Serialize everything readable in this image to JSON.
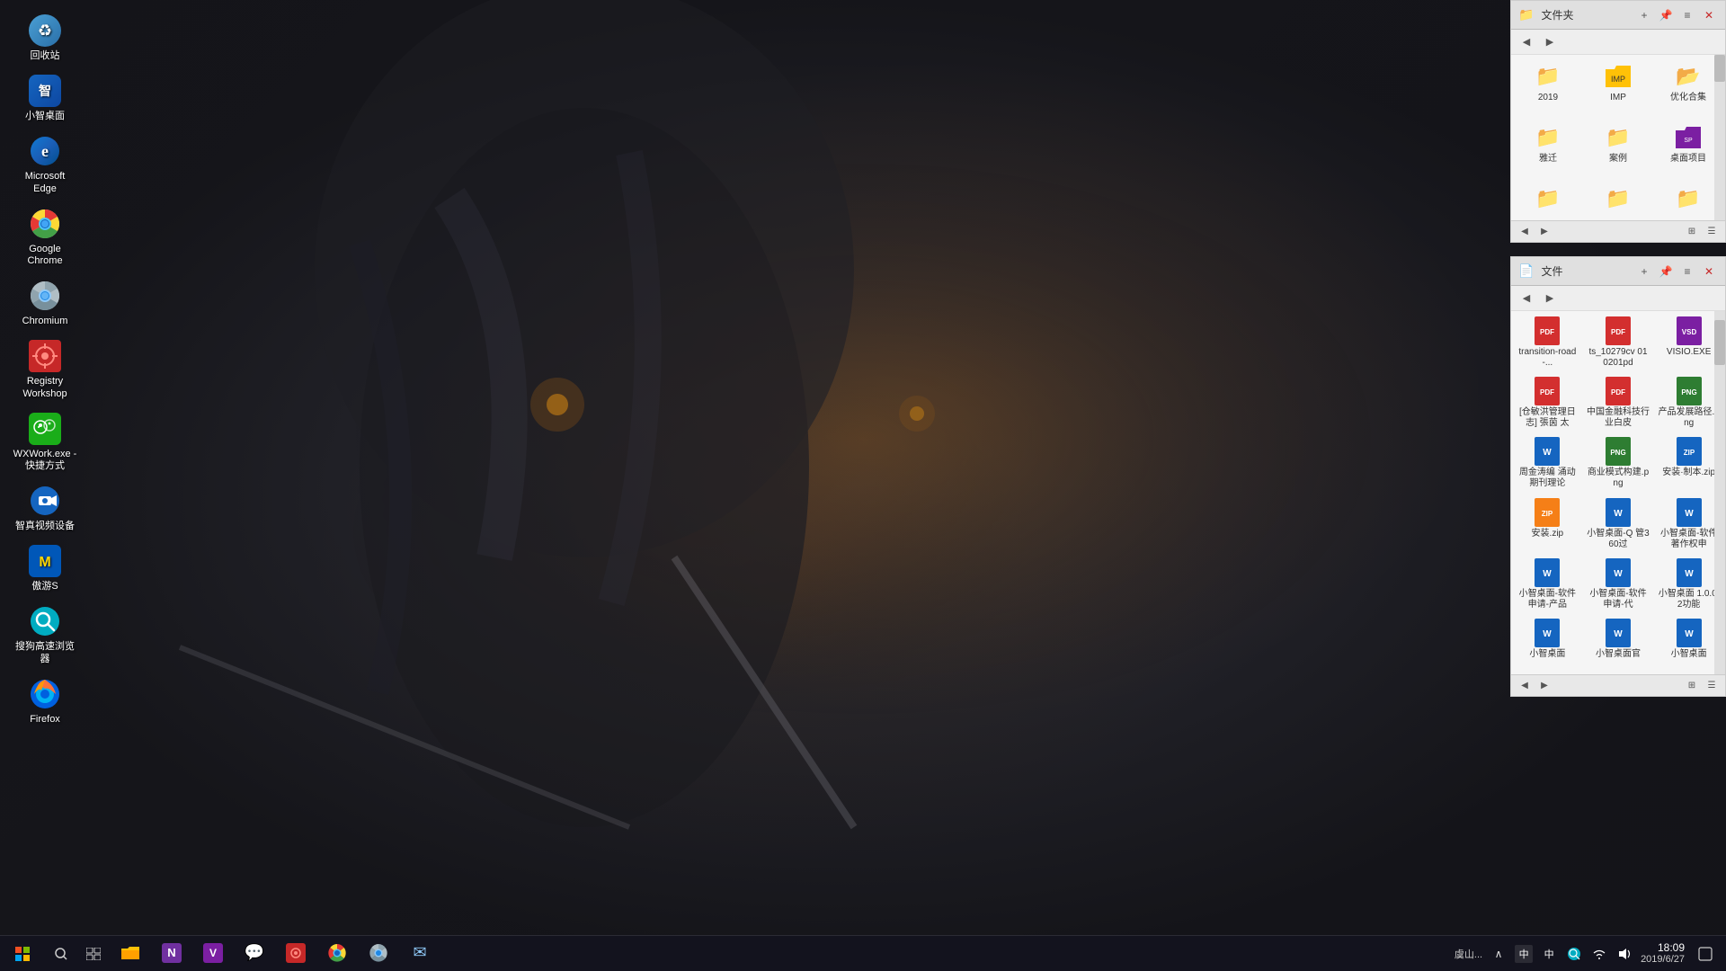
{
  "desktop": {
    "wallpaper_desc": "Dark anime hooded character with orange glowing elements"
  },
  "desktop_icons": [
    {
      "id": "recycle-bin",
      "label": "回收站",
      "icon_type": "recycle",
      "icon_char": "♻"
    },
    {
      "id": "xiaozhi",
      "label": "小智桌面",
      "icon_type": "xiaozhi",
      "icon_char": "智"
    },
    {
      "id": "ms-edge",
      "label": "Microsoft Edge",
      "icon_type": "edge",
      "icon_char": "e"
    },
    {
      "id": "google-chrome",
      "label": "Google Chrome",
      "icon_type": "chrome",
      "icon_char": ""
    },
    {
      "id": "chromium",
      "label": "Chromium",
      "icon_type": "chromium",
      "icon_char": ""
    },
    {
      "id": "registry-workshop",
      "label": "Registry Workshop",
      "icon_type": "registry",
      "icon_char": "⚙"
    },
    {
      "id": "wxwork",
      "label": "WXWork.exe - 快捷方式",
      "icon_type": "wxwork",
      "icon_char": "企"
    },
    {
      "id": "zhizhen",
      "label": "智真视频设备",
      "icon_type": "zhizhen",
      "icon_char": "📷"
    },
    {
      "id": "maxthon",
      "label": "傲游S",
      "icon_type": "maxthon",
      "icon_char": "M"
    },
    {
      "id": "sogou",
      "label": "搜狗高速浏览器",
      "icon_type": "sogou",
      "icon_char": "搜"
    },
    {
      "id": "firefox",
      "label": "Firefox",
      "icon_type": "firefox",
      "icon_char": "🦊"
    }
  ],
  "file_manager_top": {
    "title": "文件夹",
    "folders": [
      {
        "name": "2019",
        "icon": "folder",
        "color": "yellow"
      },
      {
        "name": "IMP",
        "icon": "folder-doc",
        "color": "yellow"
      },
      {
        "name": "优化合集",
        "icon": "folder",
        "color": "yellow"
      },
      {
        "name": "雅迁",
        "icon": "folder",
        "color": "yellow"
      },
      {
        "name": "案例",
        "icon": "folder",
        "color": "yellow"
      },
      {
        "name": "桌面项目",
        "icon": "folder-sp",
        "color": "purple"
      },
      {
        "name": "...",
        "icon": "folder",
        "color": "yellow"
      },
      {
        "name": "...",
        "icon": "folder",
        "color": "yellow"
      },
      {
        "name": "...",
        "icon": "folder",
        "color": "yellow"
      }
    ],
    "toolbar_buttons": [
      "+",
      "□",
      "—",
      "×"
    ],
    "scrollbar": true
  },
  "file_manager_bottom": {
    "title": "文件",
    "files": [
      {
        "name": "transition-road-...",
        "icon": "pdf",
        "color": "red"
      },
      {
        "name": "ts_10279cv 010201pd",
        "icon": "pdf",
        "color": "red"
      },
      {
        "name": "VISIO.EXE",
        "icon": "visio",
        "color": "purple"
      },
      {
        "name": "[仓敏洪管理日志] 張茵 太",
        "icon": "pdf",
        "color": "red"
      },
      {
        "name": "中国金融科技行业白皮",
        "icon": "pdf",
        "color": "red"
      },
      {
        "name": "产品发展路径.png",
        "icon": "png",
        "color": "green"
      },
      {
        "name": "周金涛编 涌动期刊理论",
        "icon": "word",
        "color": "blue"
      },
      {
        "name": "商业模式构建.png",
        "icon": "png",
        "color": "green"
      },
      {
        "name": "安装·制本.zip",
        "icon": "zip",
        "color": "blue"
      },
      {
        "name": "安装.zip",
        "icon": "zip",
        "color": "yellow"
      },
      {
        "name": "小智桌面-Q 管360过",
        "icon": "word",
        "color": "blue"
      },
      {
        "name": "小智桌面-软件著作权申",
        "icon": "word",
        "color": "blue"
      },
      {
        "name": "小智桌面-软件申请-产品",
        "icon": "word",
        "color": "blue"
      },
      {
        "name": "小智桌面-软件申请-代",
        "icon": "word",
        "color": "blue"
      },
      {
        "name": "小智桌面 1.0.0.2功能",
        "icon": "word",
        "color": "blue"
      },
      {
        "name": "小智桌面",
        "icon": "word",
        "color": "blue"
      },
      {
        "name": "小智桌面官",
        "icon": "word-sm",
        "color": "blue"
      },
      {
        "name": "小智桌面",
        "icon": "word-sm",
        "color": "blue"
      }
    ],
    "toolbar_buttons": [
      "+",
      "□",
      "—",
      "×"
    ],
    "scrollbar": true
  },
  "taskbar": {
    "start_label": "⊞",
    "search_label": "🔍",
    "taskview_label": "❑",
    "apps": [
      {
        "id": "explorer",
        "icon": "📁",
        "active": false
      },
      {
        "id": "onenote",
        "icon": "N",
        "active": false,
        "color": "#7030a0"
      },
      {
        "id": "visio",
        "icon": "V",
        "active": false,
        "color": "#7B1FA2"
      },
      {
        "id": "chat",
        "icon": "💬",
        "active": false
      },
      {
        "id": "registry",
        "icon": "⚙",
        "active": false,
        "color": "#c62828"
      },
      {
        "id": "chrome",
        "icon": "◉",
        "active": false
      },
      {
        "id": "browser2",
        "icon": "◎",
        "active": false
      },
      {
        "id": "mail",
        "icon": "✉",
        "active": false
      }
    ],
    "systray": {
      "expand_icon": "∧",
      "ime_indicator": "中",
      "lang_indicator": "中",
      "sogou_icon": "搜",
      "network_icon": "🌐",
      "volume_icon": "🔊",
      "time": "18:09",
      "date": "2019/6/27",
      "notification_icon": "🔔"
    },
    "location": "虞山..."
  }
}
